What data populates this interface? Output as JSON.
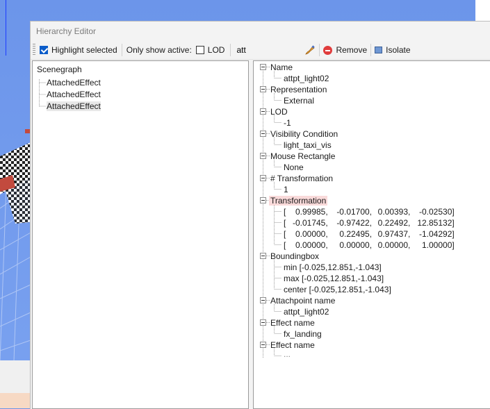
{
  "window": {
    "title": "Hierarchy Editor"
  },
  "toolbar": {
    "highlight_label": "Highlight selected",
    "highlight_checked": true,
    "only_active_label": "Only show active:",
    "lod_label": "LOD",
    "lod_checked": false,
    "filter_value": "att",
    "remove_label": "Remove",
    "isolate_label": "Isolate"
  },
  "scenegraph": {
    "title": "Scenegraph",
    "items": [
      "AttachedEffect",
      "AttachedEffect",
      "AttachedEffect"
    ],
    "selected_index": 2
  },
  "properties": {
    "name_label": "Name",
    "name_value": "attpt_light02",
    "representation_label": "Representation",
    "representation_value": "External",
    "lod_label": "LOD",
    "lod_value": "-1",
    "visibility_label": "Visibility Condition",
    "visibility_value": "light_taxi_vis",
    "mouse_rect_label": "Mouse Rectangle",
    "mouse_rect_value": "None",
    "num_transformation_label": "# Transformation",
    "num_transformation_value": "1",
    "transformation_label": "Transformation",
    "matrix": [
      [
        "0.99985,",
        "-0.01700,",
        "0.00393,",
        "-0.02530]"
      ],
      [
        "-0.01745,",
        "-0.97422,",
        "0.22492,",
        "12.85132]"
      ],
      [
        "0.00000,",
        "0.22495,",
        "0.97437,",
        "-1.04292]"
      ],
      [
        "0.00000,",
        "0.00000,",
        "0.00000,",
        "1.00000]"
      ]
    ],
    "matrix_open": "[",
    "bbox_label": "Boundingbox",
    "bbox_min": "min [-0.025,12.851,-1.043]",
    "bbox_max": "max [-0.025,12.851,-1.043]",
    "bbox_center": "center [-0.025,12.851,-1.043]",
    "attachpoint_label": "Attachpoint name",
    "attachpoint_value": "attpt_light02",
    "effect_label_1": "Effect name",
    "effect_value_1": "fx_landing",
    "effect_label_2": "Effect name",
    "effect_value_2": "..."
  },
  "colors": {
    "viewport_sky": "#6c95ea",
    "highlight_bg": "#f9dada",
    "checkbox_accent": "#0a5cc9"
  }
}
